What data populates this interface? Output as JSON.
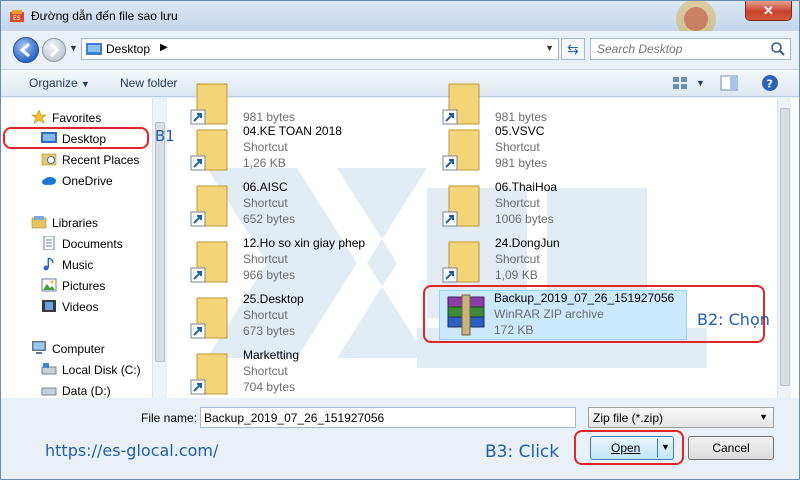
{
  "window": {
    "title": "Đường dẫn đến file sao lưu",
    "close_label": "✕"
  },
  "address": {
    "location": "Desktop",
    "search_placeholder": "Search Desktop"
  },
  "toolbar": {
    "organize": "Organize",
    "new_folder": "New folder"
  },
  "nav": {
    "favorites": "Favorites",
    "desktop": "Desktop",
    "recent": "Recent Places",
    "onedrive": "OneDrive",
    "libraries": "Libraries",
    "documents": "Documents",
    "music": "Music",
    "pictures": "Pictures",
    "videos": "Videos",
    "computer": "Computer",
    "local_disk": "Local Disk (C:)",
    "data_disk": "Data (D:)"
  },
  "files": [
    {
      "name": "",
      "type": "",
      "size": "981 bytes"
    },
    {
      "name": "",
      "type": "",
      "size": "981 bytes"
    },
    {
      "name": "04.KE TOAN 2018",
      "type": "Shortcut",
      "size": "1,26 KB"
    },
    {
      "name": "05.VSVC",
      "type": "Shortcut",
      "size": "981 bytes"
    },
    {
      "name": "06.AISC",
      "type": "Shortcut",
      "size": "652 bytes"
    },
    {
      "name": "06.ThaiHoa",
      "type": "Shortcut",
      "size": "1006 bytes"
    },
    {
      "name": "12.Ho so xin giay phep",
      "type": "Shortcut",
      "size": "966 bytes"
    },
    {
      "name": "24.DongJun",
      "type": "Shortcut",
      "size": "1,09 KB"
    },
    {
      "name": "25.Desktop",
      "type": "Shortcut",
      "size": "673 bytes"
    },
    {
      "name": "Backup_2019_07_26_151927056",
      "type": "WinRAR ZIP archive",
      "size": "172 KB"
    },
    {
      "name": "Marketting",
      "type": "Shortcut",
      "size": "704 bytes"
    }
  ],
  "bottom": {
    "file_name_label": "File name:",
    "file_name_value": "Backup_2019_07_26_151927056",
    "file_type": "Zip file (*.zip)",
    "open_label": "Open",
    "cancel_label": "Cancel"
  },
  "annotations": {
    "b1": "B1",
    "b2": "B2: Chọn",
    "b3": "B3: Click",
    "url": "https://es-glocal.com/"
  },
  "colors": {
    "accent": "#1f5fa8",
    "highlight_box": "#e0262b",
    "selection": "#cce8ff"
  }
}
